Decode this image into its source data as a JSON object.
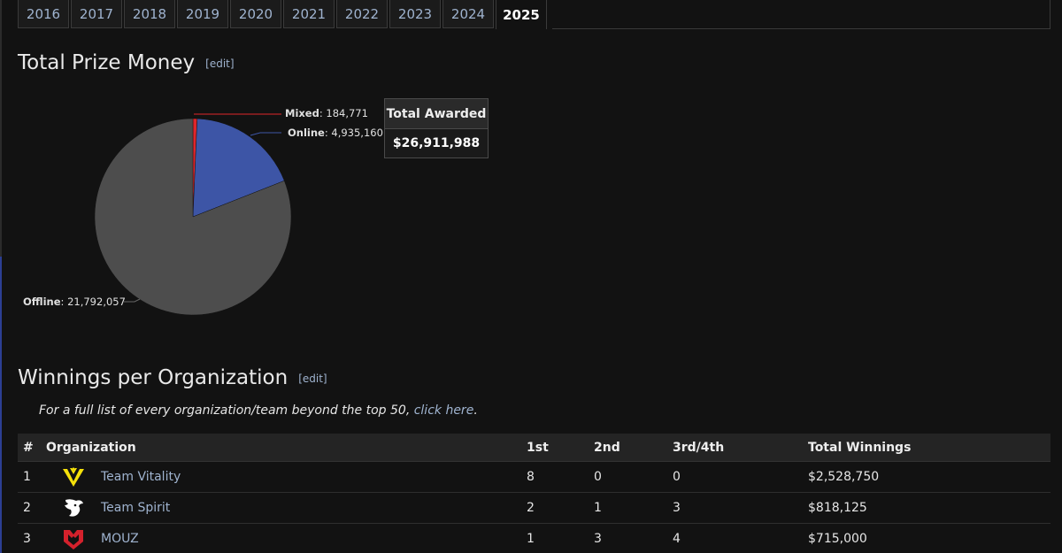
{
  "tabs": [
    {
      "label": "2016",
      "active": false
    },
    {
      "label": "2017",
      "active": false
    },
    {
      "label": "2018",
      "active": false
    },
    {
      "label": "2019",
      "active": false
    },
    {
      "label": "2020",
      "active": false
    },
    {
      "label": "2021",
      "active": false
    },
    {
      "label": "2022",
      "active": false
    },
    {
      "label": "2023",
      "active": false
    },
    {
      "label": "2024",
      "active": false
    },
    {
      "label": "2025",
      "active": true
    }
  ],
  "prize_section": {
    "title": "Total Prize Money",
    "edit_label": "[edit]"
  },
  "prize_pie": {
    "slices": [
      {
        "label": "Mixed",
        "value_text": "184,771",
        "value": 184771,
        "color": "#e0262b"
      },
      {
        "label": "Online",
        "value_text": "4,935,160",
        "value": 4935160,
        "color": "#3d55a6"
      },
      {
        "label": "Offline",
        "value_text": "21,792,057",
        "value": 21792057,
        "color": "#4d4d4d"
      }
    ]
  },
  "total_awarded": {
    "header": "Total Awarded",
    "value": "$26,911,988"
  },
  "winnings_section": {
    "title": "Winnings per Organization",
    "edit_label": "[edit]",
    "note_text": "For a full list of every organization/team beyond the top 50, ",
    "note_link": "click here",
    "note_end": "."
  },
  "table": {
    "headers": {
      "rank": "#",
      "organization": "Organization",
      "first": "1st",
      "second": "2nd",
      "third": "3rd/4th",
      "total": "Total Winnings"
    },
    "rows": [
      {
        "rank": "1",
        "logo": "team-vitality-logo",
        "name": "Team Vitality",
        "first": "8",
        "second": "0",
        "third": "0",
        "total": "$2,528,750"
      },
      {
        "rank": "2",
        "logo": "team-spirit-logo",
        "name": "Team Spirit",
        "first": "2",
        "second": "1",
        "third": "3",
        "total": "$818,125"
      },
      {
        "rank": "3",
        "logo": "mouz-logo",
        "name": "MOUZ",
        "first": "1",
        "second": "3",
        "third": "4",
        "total": "$715,000"
      }
    ]
  },
  "colors": {
    "background": "#121212",
    "link": "#9fb3cf",
    "vitality_yellow": "#f5e10a",
    "mouz_red": "#d4212c"
  }
}
